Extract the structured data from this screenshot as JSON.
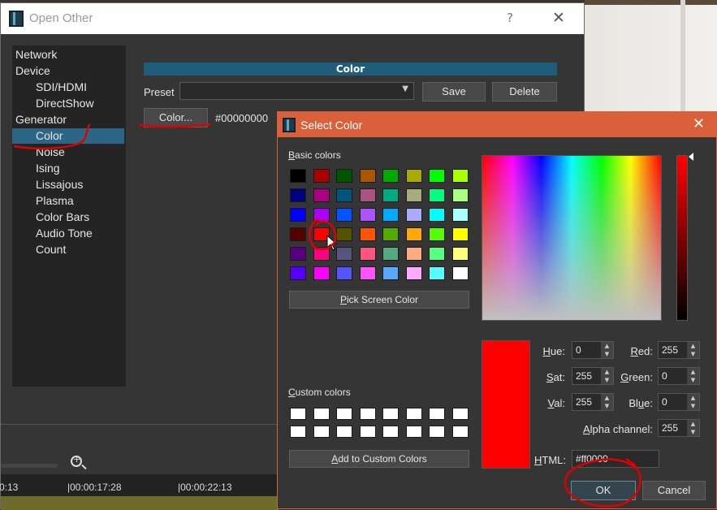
{
  "open_other": {
    "title": "Open Other",
    "help": "?",
    "close": "✕",
    "tree": [
      "Network",
      "Device",
      "SDI/HDMI",
      "DirectShow",
      "Generator",
      "Color",
      "Noise",
      "Ising",
      "Lissajous",
      "Plasma",
      "Color Bars",
      "Audio Tone",
      "Count"
    ],
    "section_header": "Color",
    "preset_label": "Preset",
    "preset_value": "",
    "save": "Save",
    "delete": "Delete",
    "color_button": "Color...",
    "color_value": "#00000000"
  },
  "timeline": {
    "times": [
      "0:13",
      "|00:00:17:28",
      "|00:00:22:13"
    ]
  },
  "select_color": {
    "title": "Select Color",
    "close": "✕",
    "basic_colors_label": "Basic colors",
    "basic_colors": [
      "#000000",
      "#aa0000",
      "#005500",
      "#aa5500",
      "#00aa00",
      "#aaaa00",
      "#00ff00",
      "#aaff00",
      "#00007f",
      "#aa007f",
      "#00557f",
      "#aa557f",
      "#00aa7f",
      "#aaaa7f",
      "#00ff7f",
      "#aaff7f",
      "#0000ff",
      "#aa00ff",
      "#0055ff",
      "#aa55ff",
      "#00aaff",
      "#aaaaff",
      "#00ffff",
      "#aaffff",
      "#550000",
      "#ff0000",
      "#555500",
      "#ff5500",
      "#55aa00",
      "#ffaa00",
      "#55ff00",
      "#ffff00",
      "#55007f",
      "#ff007f",
      "#55557f",
      "#ff557f",
      "#55aa7f",
      "#ffaa7f",
      "#55ff7f",
      "#ffff7f",
      "#5500ff",
      "#ff00ff",
      "#5555ff",
      "#ff55ff",
      "#55aaff",
      "#ffaaff",
      "#55ffff",
      "#ffffff"
    ],
    "pick_screen": "Pick Screen Color",
    "custom_colors_label": "Custom colors",
    "add_custom": "Add to Custom Colors",
    "hue_label": "Hue:",
    "hue": "0",
    "sat_label": "Sat:",
    "sat": "255",
    "val_label": "Val:",
    "val": "255",
    "red_label": "Red:",
    "red": "255",
    "green_label": "Green:",
    "green": "0",
    "blue_label": "Blue:",
    "blue": "0",
    "alpha_label": "Alpha channel:",
    "alpha": "255",
    "html_label": "HTML:",
    "html": "#ff0000",
    "ok": "OK",
    "cancel": "Cancel",
    "selected_color": "#ff0000"
  },
  "annotation_color": "#e00000"
}
